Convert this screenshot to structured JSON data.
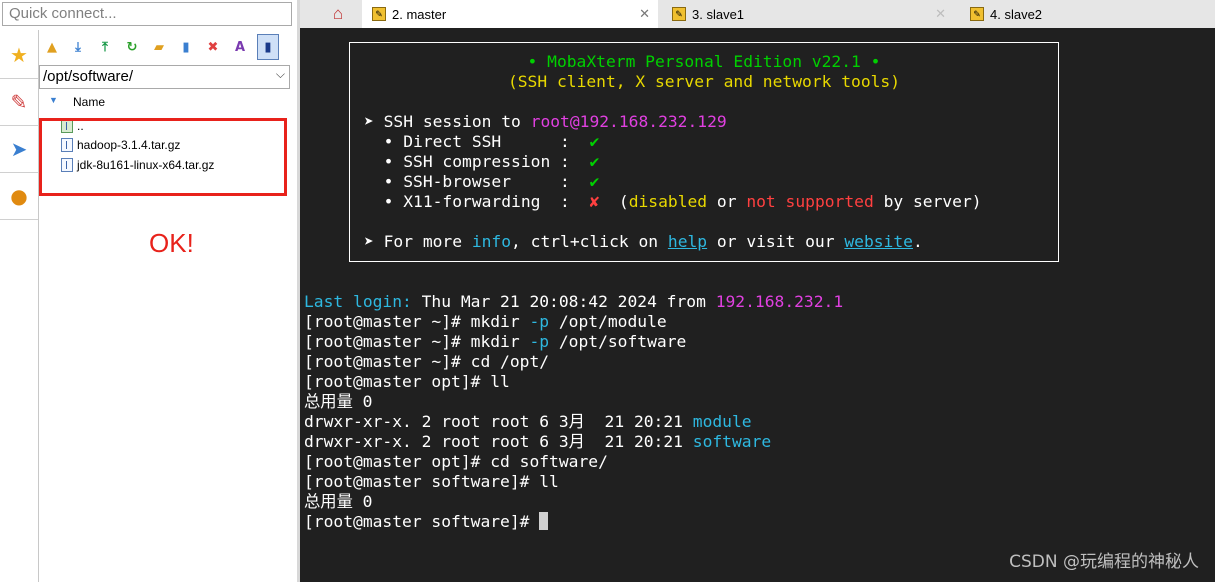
{
  "quick_connect": {
    "placeholder": "Quick connect..."
  },
  "sidebar_icons": [
    "star-icon",
    "tools-icon",
    "paper-plane-icon",
    "globe-icon"
  ],
  "file_browser": {
    "path": "/opt/software/",
    "column_header": "Name",
    "items": [
      {
        "name": "..",
        "type": "parent"
      },
      {
        "name": "hadoop-3.1.4.tar.gz",
        "type": "file"
      },
      {
        "name": "jdk-8u161-linux-x64.tar.gz",
        "type": "file"
      }
    ],
    "annotation": "OK!"
  },
  "tabs": [
    {
      "label": "2. master",
      "active": true
    },
    {
      "label": "3. slave1",
      "active": false
    },
    {
      "label": "4. slave2",
      "active": false
    }
  ],
  "banner": {
    "title": "• MobaXterm Personal Edition v22.1 •",
    "subtitle": "(SSH client, X server and network tools)",
    "session_prefix": "➤ SSH session to ",
    "session_target": "root@192.168.232.129",
    "rows": [
      {
        "label": "  • Direct SSH      :  ",
        "mark": "✔"
      },
      {
        "label": "  • SSH compression :  ",
        "mark": "✔"
      },
      {
        "label": "  • SSH-browser     :  ",
        "mark": "✔"
      }
    ],
    "x11_label": "  • X11-forwarding  :  ",
    "x11_mark": "✘",
    "x11_open": "  (",
    "x11_disabled": "disabled",
    "x11_or": " or ",
    "x11_not_supported": "not supported",
    "x11_end": " by server)",
    "more_prefix": "➤ For more ",
    "more_info": "info",
    "more_mid": ", ctrl+click on ",
    "more_help": "help",
    "more_mid2": " or visit our ",
    "more_website": "website",
    "more_end": "."
  },
  "terminal": {
    "last_login_label": "Last login:",
    "last_login_text": " Thu Mar 21 20:08:42 2024 from ",
    "last_login_ip": "192.168.232.1",
    "cmd1_prompt": "[root@master ~]# mkdir ",
    "cmd1_flag": "-p",
    "cmd1_arg": " /opt/module",
    "cmd2_prompt": "[root@master ~]# mkdir ",
    "cmd2_flag": "-p",
    "cmd2_arg": " /opt/software",
    "cmd3": "[root@master ~]# cd /opt/",
    "cmd4": "[root@master opt]# ll",
    "total1": "总用量 0",
    "dir1_perm": "drwxr-xr-x. 2 root root 6 3月  21 20:21 ",
    "dir1_name": "module",
    "dir2_perm": "drwxr-xr-x. 2 root root 6 3月  21 20:21 ",
    "dir2_name": "software",
    "cmd5": "[root@master opt]# cd software/",
    "cmd6": "[root@master software]# ll",
    "total2": "总用量 0",
    "prompt_final": "[root@master software]# "
  },
  "watermark": "CSDN @玩编程的神秘人"
}
